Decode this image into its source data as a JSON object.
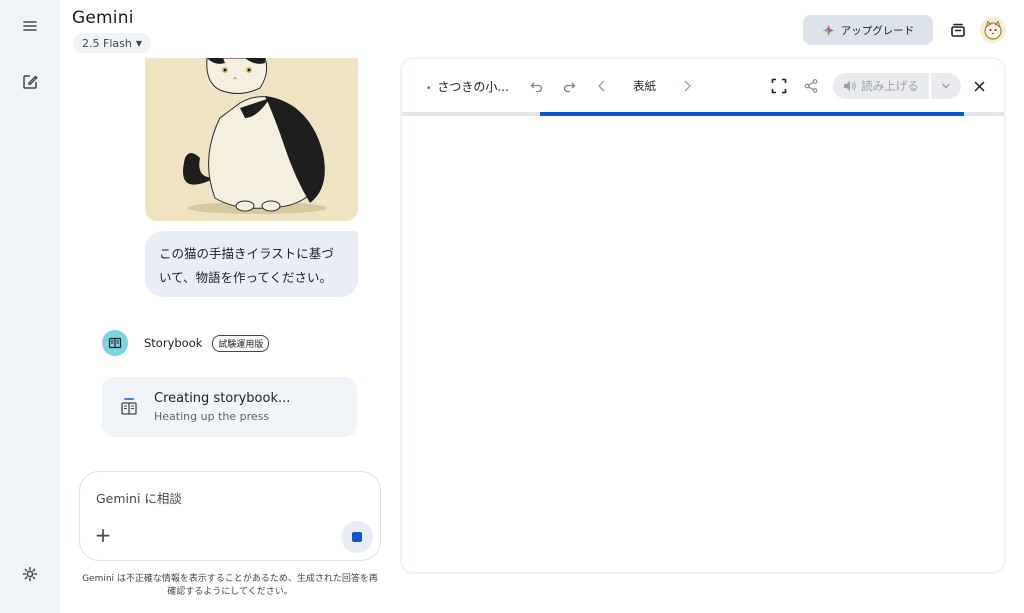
{
  "app": {
    "title": "Gemini",
    "model": "2.5 Flash",
    "upgrade_label": "アップグレード"
  },
  "chat": {
    "user_prompt": "この猫の手描きイラストに基づいて、物語を作ってください。",
    "agent_name": "Storybook",
    "agent_badge": "試験運用版",
    "status_title": "Creating storybook...",
    "status_subtitle": "Heating up the press"
  },
  "input": {
    "placeholder": "Gemini に相談",
    "disclaimer": "Gemini は不正確な情報を表示することがあるため、生成された回答を再確認するようにしてください。"
  },
  "canvas": {
    "doc_title": "さつきの小...",
    "page_label": "表紙",
    "read_aloud_label": "読み上げる"
  },
  "colors": {
    "accent": "#0b57d0",
    "rail_bg": "#f0f4f9",
    "storybook_avatar": "#7fd3dd"
  },
  "icons": [
    "menu-icon",
    "new-chat-icon",
    "settings-icon",
    "sparkle-icon",
    "inbox-icon",
    "book-icon",
    "undo-icon",
    "redo-icon",
    "chevron-left-icon",
    "chevron-right-icon",
    "fullscreen-icon",
    "share-icon",
    "speaker-icon",
    "chevron-down-icon",
    "close-icon",
    "plus-icon",
    "stop-icon"
  ]
}
